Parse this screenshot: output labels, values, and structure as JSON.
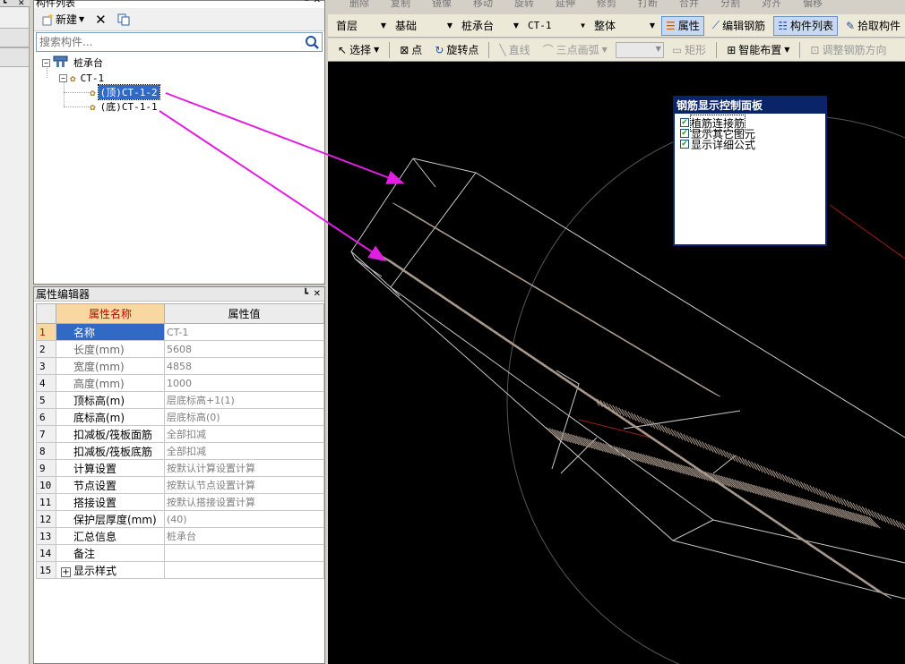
{
  "tree_panel": {
    "title": "构件列表",
    "new_button": "新建",
    "search_placeholder": "搜索构件...",
    "root": "桩承台",
    "group": "CT-1",
    "items": [
      "(顶)CT-1-2",
      "(底)CT-1-1"
    ],
    "selected_index": 0
  },
  "prop_panel": {
    "title": "属性编辑器",
    "col_name": "属性名称",
    "col_value": "属性值",
    "rows": [
      {
        "num": "1",
        "name": "名称",
        "value": "CT-1"
      },
      {
        "num": "2",
        "name": "长度(mm)",
        "value": "5608"
      },
      {
        "num": "3",
        "name": "宽度(mm)",
        "value": "4858"
      },
      {
        "num": "4",
        "name": "高度(mm)",
        "value": "1000"
      },
      {
        "num": "5",
        "name": "顶标高(m)",
        "value": "层底标高+1(1)"
      },
      {
        "num": "6",
        "name": "底标高(m)",
        "value": "层底标高(0)"
      },
      {
        "num": "7",
        "name": "扣减板/筏板面筋",
        "value": "全部扣减"
      },
      {
        "num": "8",
        "name": "扣减板/筏板底筋",
        "value": "全部扣减"
      },
      {
        "num": "9",
        "name": "计算设置",
        "value": "按默认计算设置计算"
      },
      {
        "num": "10",
        "name": "节点设置",
        "value": "按默认节点设置计算"
      },
      {
        "num": "11",
        "name": "搭接设置",
        "value": "按默认搭接设置计算"
      },
      {
        "num": "12",
        "name": "保护层厚度(mm)",
        "value": "(40)"
      },
      {
        "num": "13",
        "name": "汇总信息",
        "value": "桩承台"
      },
      {
        "num": "14",
        "name": "备注",
        "value": ""
      },
      {
        "num": "15",
        "name": "显示样式",
        "value": ""
      }
    ]
  },
  "toolbar_top": {
    "faded": [
      "删除",
      "复制",
      "镜像",
      "移动",
      "旋转",
      "延伸",
      "修剪",
      "打断",
      "合并",
      "分割",
      "对齐",
      "偏移"
    ]
  },
  "toolbar1": {
    "floor": "首层",
    "category": "基础",
    "type": "桩承台",
    "component": "CT-1",
    "scope": "整体",
    "btn_property": "属性",
    "btn_edit_rebar": "编辑钢筋",
    "btn_component_list": "构件列表",
    "btn_pick": "拾取构件"
  },
  "toolbar2": {
    "select": "选择",
    "point": "点",
    "rotate_point": "旋转点",
    "line": "直线",
    "arc": "三点画弧",
    "rect": "矩形",
    "smart": "智能布置",
    "adjust": "调整钢筋方向"
  },
  "rebar_panel": {
    "title": "钢筋显示控制面板",
    "options": [
      "植筋连接筋",
      "显示其它图元",
      "显示详细公式"
    ]
  },
  "colors": {
    "selection": "#316ac5",
    "arrow": "#e020e0",
    "rebar": "#a8988c",
    "wire": "#c8c8c8"
  }
}
